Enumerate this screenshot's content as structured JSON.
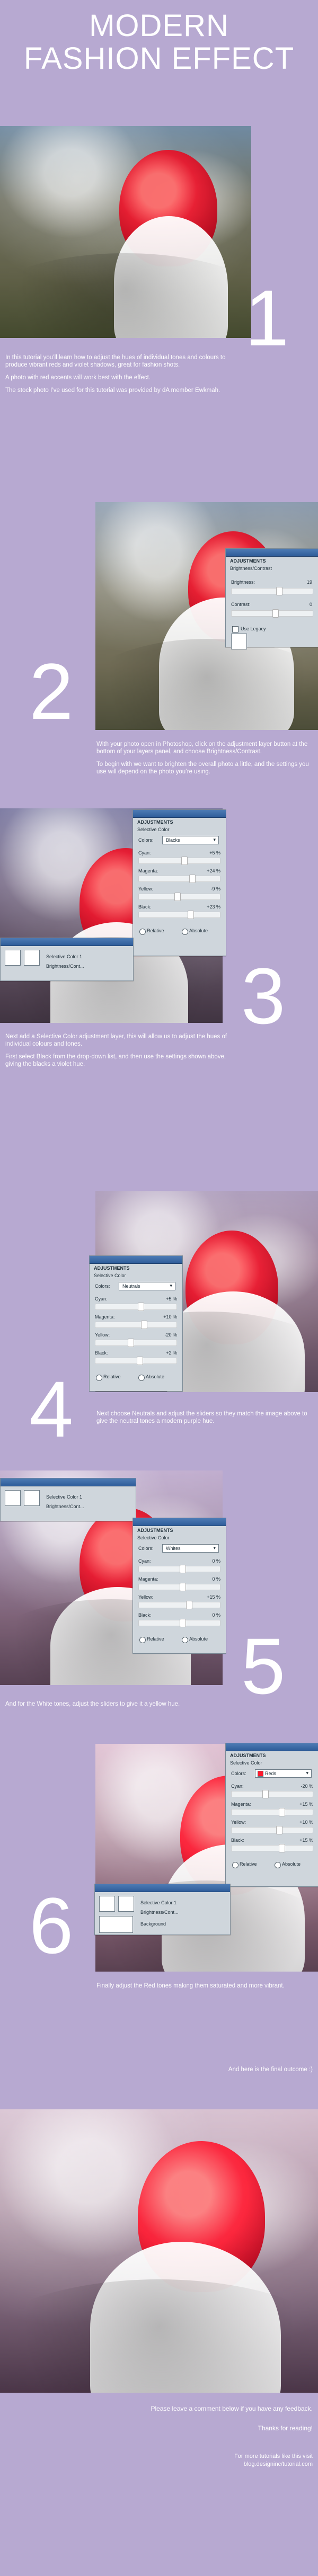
{
  "header": {
    "title_line1": "MODERN",
    "title_line2": "FASHION EFFECT"
  },
  "sections": [
    {
      "number": "1",
      "paragraphs": [
        "In this tutorial you’ll learn how to adjust the hues of individual tones and colours to produce vibrant reds and violet shadows, great for fashion shots.",
        "A photo with red accents will work best with the effect.",
        "The stock photo I’ve used for this tutorial was provided by dA member Ewkmah."
      ]
    },
    {
      "number": "2",
      "paragraphs": [
        "With your photo open in Photoshop, click on the adjustment layer button at the bottom of your layers panel, and choose Brightness/Contrast.",
        "To begin with we want to brighten the overall photo a little, and the settings you use will depend on the photo you’re using."
      ]
    },
    {
      "number": "3",
      "paragraphs": [
        "Next add a Selective Color adjustment layer, this will allow us to adjust the hues of individual colours and tones.",
        "First select Black from the drop-down list, and then use the settings shown above, giving the blacks a violet hue."
      ]
    },
    {
      "number": "4",
      "paragraphs": [
        "Next choose Neutrals and adjust the sliders so they match the image above to give the neutral tones a modern purple hue."
      ]
    },
    {
      "number": "5",
      "paragraphs": [
        "And for the White tones, adjust the sliders to give it a yellow hue."
      ]
    },
    {
      "number": "6",
      "paragraphs": [
        "Finally adjust the Red tones making them saturated and more vibrant."
      ]
    }
  ],
  "final": {
    "intro": "And here is the final outcome :)",
    "comment": "Please leave a comment below if you have any feedback.",
    "thanks": "Thanks for reading!",
    "more_line1": "For more tutorials like this visit",
    "more_line2": "blog.designinc/tutorial.com"
  },
  "panels": {
    "brightness": {
      "title": "ADJUSTMENTS",
      "subtitle": "Brightness/Contrast",
      "labels": [
        "Brightness:",
        "Contrast:"
      ],
      "values": [
        "19",
        "0"
      ],
      "legacy": "Use Legacy"
    },
    "selective_black": {
      "title": "ADJUSTMENTS",
      "subtitle": "Selective Color",
      "colors_label": "Colors:",
      "colors_value": "Blacks",
      "labels": [
        "Cyan:",
        "Magenta:",
        "Yellow:",
        "Black:"
      ],
      "values": [
        "+5 %",
        "+24 %",
        "-9 %",
        "+23 %"
      ],
      "method_relative": "Relative",
      "method_absolute": "Absolute"
    },
    "selective_neutral": {
      "title": "ADJUSTMENTS",
      "subtitle": "Selective Color",
      "colors_label": "Colors:",
      "colors_value": "Neutrals",
      "labels": [
        "Cyan:",
        "Magenta:",
        "Yellow:",
        "Black:"
      ],
      "values": [
        "+5 %",
        "+10 %",
        "-20 %",
        "+2 %"
      ],
      "method_relative": "Relative",
      "method_absolute": "Absolute"
    },
    "selective_white": {
      "title": "ADJUSTMENTS",
      "subtitle": "Selective Color",
      "colors_label": "Colors:",
      "colors_value": "Whites",
      "labels": [
        "Cyan:",
        "Magenta:",
        "Yellow:",
        "Black:"
      ],
      "values": [
        "0 %",
        "0 %",
        "+15 %",
        "0 %"
      ],
      "method_relative": "Relative",
      "method_absolute": "Absolute"
    },
    "selective_red": {
      "title": "ADJUSTMENTS",
      "subtitle": "Selective Color",
      "colors_label": "Colors:",
      "colors_value": "Reds",
      "labels": [
        "Cyan:",
        "Magenta:",
        "Yellow:",
        "Black:"
      ],
      "values": [
        "-20 %",
        "+15 %",
        "+10 %",
        "+15 %"
      ],
      "method_relative": "Relative",
      "method_absolute": "Absolute"
    },
    "layers_small": {
      "layer_1": "Selective Color 1",
      "layer_2": "Brightness/Cont...",
      "layer_3": "Background"
    }
  },
  "colors": {
    "page_bg": "#b7a9d1",
    "photo_warm": "#f3c6ad",
    "photo_violet": "#c7b0e6",
    "accent_red": "#ff1b2d"
  }
}
